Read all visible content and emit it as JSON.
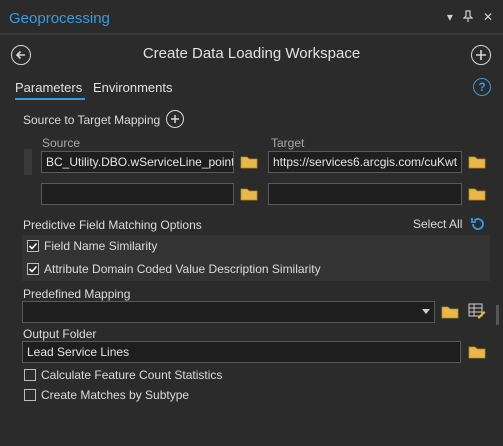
{
  "pane": {
    "title": "Geoprocessing",
    "pin_glyph": "▾",
    "close_glyph": "✕"
  },
  "tool": {
    "title": "Create Data Loading Workspace"
  },
  "tabs": [
    {
      "label": "Parameters",
      "active": true
    },
    {
      "label": "Environments",
      "active": false
    }
  ],
  "help_glyph": "?",
  "mapping": {
    "label": "Source to Target Mapping",
    "source_header": "Source",
    "target_header": "Target",
    "rows": [
      {
        "source": "BC_Utility.DBO.wServiceLine_point",
        "target": "https://services6.arcgis.com/cuKwt"
      },
      {
        "source": "",
        "target": ""
      }
    ]
  },
  "matching": {
    "label": "Predictive Field Matching Options",
    "select_all": "Select All",
    "options": [
      {
        "label": "Field Name Similarity",
        "checked": true
      },
      {
        "label": "Attribute Domain Coded Value Description Similarity",
        "checked": true
      }
    ]
  },
  "predefined": {
    "label": "Predefined Mapping",
    "value": ""
  },
  "output": {
    "label": "Output Folder",
    "value": "Lead Service Lines"
  },
  "extras": [
    {
      "label": "Calculate Feature Count Statistics",
      "checked": false
    },
    {
      "label": "Create Matches by Subtype",
      "checked": false
    }
  ],
  "colors": {
    "accent": "#3a9ae0",
    "folder": "#e8b84a",
    "background": "#2b2b2b"
  }
}
